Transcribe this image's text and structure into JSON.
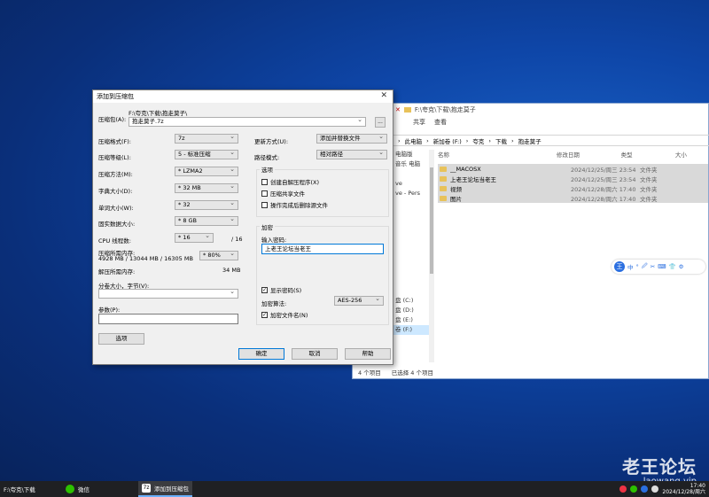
{
  "explorer": {
    "title_path": "F:\\夸克\\下载\\抱走莫子",
    "ribbon_tabs": [
      "共享",
      "查看"
    ],
    "address": [
      "此电脑",
      "新加卷 (F:)",
      "夸克",
      "下载",
      "抱走莫子"
    ],
    "nav_items": [
      "电脑版",
      "音乐 电脑",
      "",
      "ve",
      "ve - Pers",
      "",
      "",
      "",
      "",
      "",
      "",
      "",
      "",
      "",
      "",
      "盘 (C:)",
      "盘 (D:)",
      "盘 (E:)",
      "卷 (F:)"
    ],
    "columns": [
      "名称",
      "修改日期",
      "类型",
      "大小"
    ],
    "rows": [
      {
        "name": "__MACOSX",
        "date": "2024/12/25/周三 23:54",
        "type": "文件夹"
      },
      {
        "name": "上老王论坛当老王",
        "date": "2024/12/25/周三 23:54",
        "type": "文件夹"
      },
      {
        "name": "视频",
        "date": "2024/12/28/周六 17:40",
        "type": "文件夹"
      },
      {
        "name": "图片",
        "date": "2024/12/28/周六 17:40",
        "type": "文件夹"
      }
    ],
    "status_count": "4 个项目",
    "status_selected": "已选择 4 个项目"
  },
  "floatbar": {
    "logo": "王",
    "items": [
      "中",
      "°",
      "🖉",
      "✂",
      "⌨",
      "👕",
      "⚙"
    ]
  },
  "dialog": {
    "title": "添加到压缩包",
    "archive_label": "压缩包(A):",
    "archive_path": "F:\\夸克\\下载\\抱走莫子\\",
    "archive_name": "抱走莫子.7z",
    "browse_label": "...",
    "format_label": "压缩格式(F):",
    "format_value": "7z",
    "level_label": "压缩等级(L):",
    "level_value": "5 - 标准压缩",
    "method_label": "压缩方法(M):",
    "method_value": "* LZMA2",
    "dict_label": "字典大小(D):",
    "dict_value": "* 32 MB",
    "word_label": "单词大小(W):",
    "word_value": "* 32",
    "solid_label": "固实数据大小:",
    "solid_value": "* 8 GB",
    "threads_label": "CPU 线程数:",
    "threads_value": "* 16",
    "threads_total": "/ 16",
    "mem_label": "压缩所需内存:",
    "mem_values": "4928 MB / 13044 MB / 16305 MB",
    "mem_percent": "* 80%",
    "decomp_label": "解压所需内存:",
    "decomp_value": "34 MB",
    "split_label": "分卷大小，字节(V):",
    "split_value": "",
    "params_label": "参数(P):",
    "params_value": "",
    "options_button": "选项",
    "update_label": "更新方式(U):",
    "update_value": "添加并替换文件",
    "path_label": "路径模式:",
    "path_value": "相对路径",
    "options_group": "选项",
    "opt_sfx": "创建自解压程序(X)",
    "opt_shared": "压缩共享文件",
    "opt_delete": "操作完成后删除源文件",
    "encrypt_group": "加密",
    "password_label": "输入密码:",
    "password_value": "上老王论坛当老王",
    "show_password": "显示密码(S)",
    "enc_method_label": "加密算法:",
    "enc_method_value": "AES-256",
    "encrypt_names": "加密文件名(N)",
    "ok": "确定",
    "cancel": "取消",
    "help": "帮助"
  },
  "watermark": {
    "title": "老王论坛",
    "url": "laowang.vip"
  },
  "taskbar": {
    "items": [
      "F:\\夸克\\下载",
      "微信",
      "添加到压缩包"
    ],
    "time": "17:40",
    "date": "2024/12/28/周六"
  }
}
